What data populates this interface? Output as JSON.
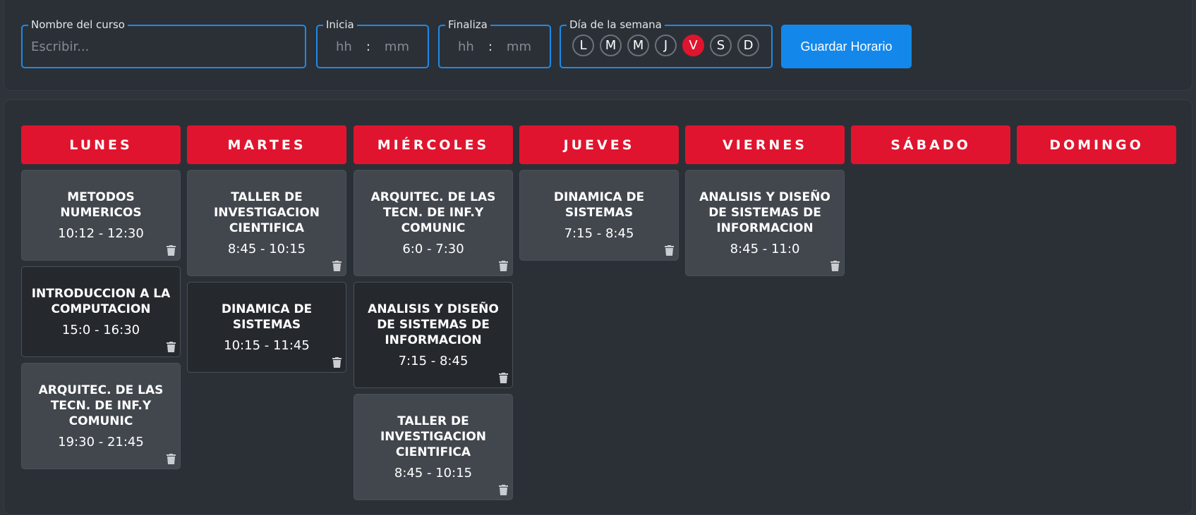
{
  "form": {
    "course_label": "Nombre del curso",
    "course_placeholder": "Escribir...",
    "start_label": "Inicia",
    "end_label": "Finaliza",
    "hh_placeholder": "hh",
    "mm_placeholder": "mm",
    "time_separator": ":",
    "weekday_label": "Día de la semana",
    "weekdays": [
      "L",
      "M",
      "M",
      "J",
      "V",
      "S",
      "D"
    ],
    "selected_weekday": "V",
    "save_label": "Guardar Horario"
  },
  "schedule": {
    "days": [
      {
        "name": "LUNES",
        "courses": [
          {
            "name": "METODOS NUMERICOS",
            "time": "10:12 - 12:30"
          },
          {
            "name": "INTRODUCCION A LA COMPUTACION",
            "time": "15:0 - 16:30"
          },
          {
            "name": "ARQUITEC. DE LAS TECN. DE INF.Y COMUNIC",
            "time": "19:30 - 21:45"
          }
        ]
      },
      {
        "name": "MARTES",
        "courses": [
          {
            "name": "TALLER DE INVESTIGACION CIENTIFICA",
            "time": "8:45 - 10:15"
          },
          {
            "name": "DINAMICA DE SISTEMAS",
            "time": "10:15 - 11:45"
          }
        ]
      },
      {
        "name": "MIÉRCOLES",
        "courses": [
          {
            "name": "ARQUITEC. DE LAS TECN. DE INF.Y COMUNIC",
            "time": "6:0 - 7:30"
          },
          {
            "name": "ANALISIS Y DISEÑO DE SISTEMAS DE INFORMACION",
            "time": "7:15 - 8:45"
          },
          {
            "name": "TALLER DE INVESTIGACION CIENTIFICA",
            "time": "8:45 - 10:15"
          }
        ]
      },
      {
        "name": "JUEVES",
        "courses": [
          {
            "name": "DINAMICA DE SISTEMAS",
            "time": "7:15 - 8:45"
          }
        ]
      },
      {
        "name": "VIERNES",
        "courses": [
          {
            "name": "ANALISIS Y DISEÑO DE SISTEMAS DE INFORMACION",
            "time": "8:45 - 11:0"
          }
        ]
      },
      {
        "name": "SÁBADO",
        "courses": []
      },
      {
        "name": "DOMINGO",
        "courses": []
      }
    ]
  },
  "icons": {
    "delete": "trash-icon"
  },
  "colors": {
    "accent_red": "#e0142e",
    "accent_blue": "#1488ea"
  }
}
